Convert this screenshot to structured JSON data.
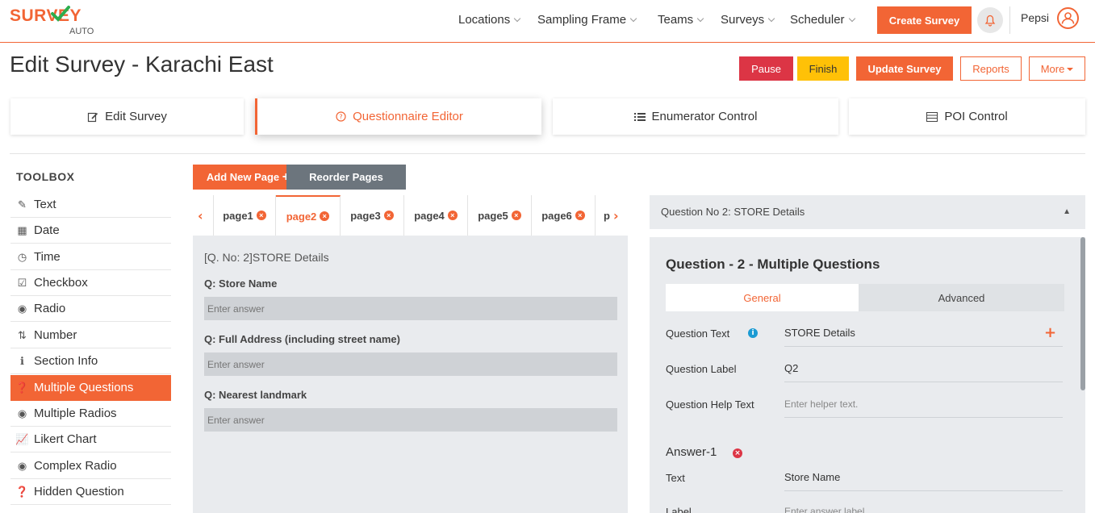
{
  "brand": {
    "logo_main": "SURVEY",
    "logo_sub": "AUTO",
    "accent": "#f26535"
  },
  "nav": {
    "items": [
      "Locations",
      "Sampling Frame",
      "Teams",
      "Surveys",
      "Scheduler"
    ],
    "create_label": "Create Survey",
    "user": "Pepsi",
    "bell_icon": "bell-icon",
    "avatar_icon": "user-circle-icon"
  },
  "header": {
    "title": "Edit Survey - Karachi East",
    "pause": "Pause",
    "finish": "Finish",
    "update": "Update Survey",
    "reports": "Reports",
    "more": "More"
  },
  "main_tabs": [
    {
      "label": "Edit Survey",
      "icon": "edit-icon"
    },
    {
      "label": "Questionnaire Editor",
      "icon": "question-circle-icon"
    },
    {
      "label": "Enumerator Control",
      "icon": "list-icon"
    },
    {
      "label": "POI Control",
      "icon": "table-icon"
    }
  ],
  "toolbox": {
    "title": "TOOLBOX",
    "items": [
      {
        "label": "Text",
        "icon": "pencil-icon"
      },
      {
        "label": "Date",
        "icon": "calendar-icon"
      },
      {
        "label": "Time",
        "icon": "clock-icon"
      },
      {
        "label": "Checkbox",
        "icon": "checkbox-icon"
      },
      {
        "label": "Radio",
        "icon": "radio-icon"
      },
      {
        "label": "Number",
        "icon": "sort-number-icon"
      },
      {
        "label": "Section Info",
        "icon": "info-icon"
      },
      {
        "label": "Multiple Questions",
        "icon": "question-circle-icon"
      },
      {
        "label": "Multiple Radios",
        "icon": "radio-icon"
      },
      {
        "label": "Likert Chart",
        "icon": "chart-line-icon"
      },
      {
        "label": "Complex Radio",
        "icon": "radio-icon"
      },
      {
        "label": "Hidden Question",
        "icon": "question-circle-icon"
      }
    ]
  },
  "page_tools": {
    "add_page": "Add New Page",
    "reorder": "Reorder Pages"
  },
  "pages": [
    "page1",
    "page2",
    "page3",
    "page4",
    "page5",
    "page6",
    "p"
  ],
  "question_preview": {
    "header": "[Q. No: 2]STORE Details",
    "questions": [
      {
        "label": "Q: Store Name",
        "placeholder": "Enter answer"
      },
      {
        "label": "Q: Full Address (including street name)",
        "placeholder": "Enter answer"
      },
      {
        "label": "Q: Nearest landmark",
        "placeholder": "Enter answer"
      }
    ]
  },
  "question_select": "Question No 2: STORE Details",
  "editor": {
    "title": "Question - 2 - Multiple Questions",
    "tab_general": "General",
    "tab_advanced": "Advanced",
    "fields": [
      {
        "label": "Question Text",
        "value": "STORE Details"
      },
      {
        "label": "Question Label",
        "value": "Q2"
      },
      {
        "label": "Question Help Text",
        "placeholder": "Enter helper text."
      }
    ],
    "answer_title": "Answer-1",
    "answer_fields": [
      {
        "label": "Text",
        "value": "Store Name"
      },
      {
        "label": "Label",
        "placeholder": "Enter answer label"
      }
    ]
  }
}
